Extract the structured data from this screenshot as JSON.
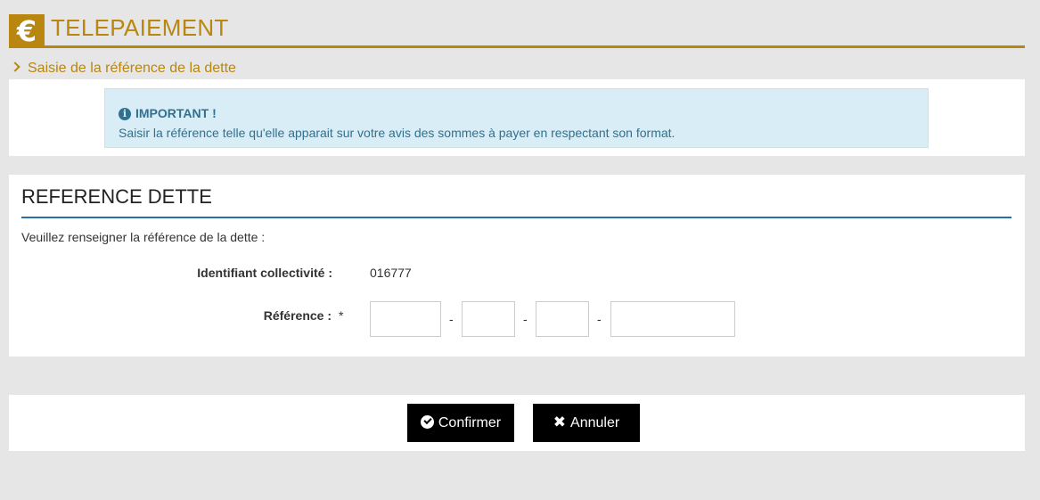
{
  "header": {
    "logo_symbol": "€",
    "title": "TELEPAIEMENT",
    "accent_color": "#b9860f"
  },
  "breadcrumb": {
    "label": "Saisie de la référence de la dette"
  },
  "alert": {
    "icon": "info-icon",
    "title": "IMPORTANT !",
    "text": "Saisir la référence telle qu'elle apparait sur votre avis des sommes à payer en respectant son format."
  },
  "form": {
    "section_title": "REFERENCE DETTE",
    "intro": "Veuillez renseigner la référence de la dette :",
    "identifiant_label": "Identifiant collectivité :",
    "identifiant_value": "016777",
    "reference_label": "Référence :",
    "required_mark": "*",
    "separator": "-",
    "reference_fields": [
      {
        "value": ""
      },
      {
        "value": ""
      },
      {
        "value": ""
      },
      {
        "value": ""
      }
    ]
  },
  "actions": {
    "confirm_label": "Confirmer",
    "confirm_icon": "check-circle-icon",
    "cancel_label": "Annuler",
    "cancel_icon": "close-icon"
  }
}
